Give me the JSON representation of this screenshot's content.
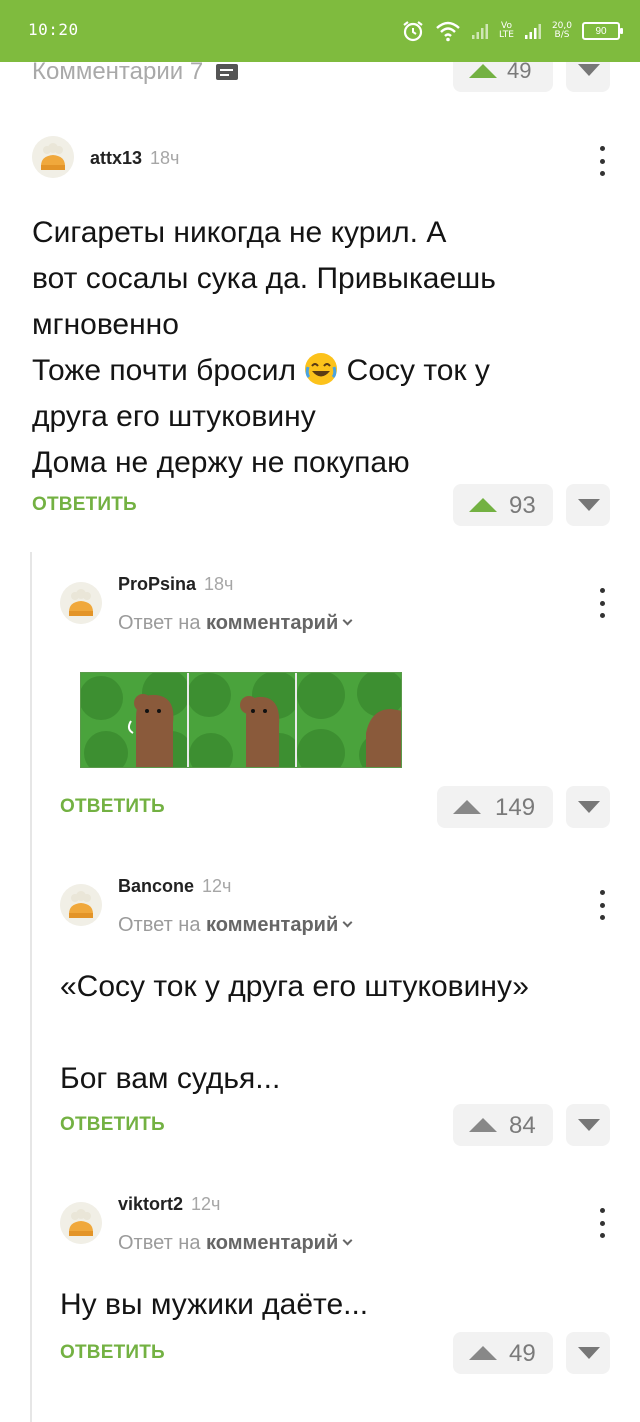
{
  "status_bar": {
    "time": "10:20",
    "volte": "Vo",
    "lte": "LTE",
    "net_speed_value": "20,0",
    "net_speed_unit": "B/S",
    "battery": "90"
  },
  "header": {
    "comments_label": "Комментарии 7",
    "rating": "49"
  },
  "comments": [
    {
      "author": "attx13",
      "time": "18ч",
      "lines": [
        "Сигареты никогда не курил. А",
        "вот сосалы сука да. Привыкаешь",
        "мгновенно"
      ],
      "line_emoji_before": "Тоже почти бросил",
      "line_emoji_after": "Сосу ток у",
      "lines2": [
        "друга его штуковину",
        "Дома не держу не покупаю"
      ],
      "reply_label": "Ответить",
      "rating": "93"
    },
    {
      "author": "ProPsina",
      "time": "18ч",
      "reply_prefix": "Ответ на",
      "reply_target": "комментарий",
      "reply_label": "Ответить",
      "rating": "149"
    },
    {
      "author": "Bancone",
      "time": "12ч",
      "reply_prefix": "Ответ на",
      "reply_target": "комментарий",
      "quote": "«Сосу ток у друга его штуковину»",
      "text": "Бог вам судья...",
      "reply_label": "Ответить",
      "rating": "84"
    },
    {
      "author": "viktort2",
      "time": "12ч",
      "reply_prefix": "Ответ на",
      "reply_target": "комментарий",
      "text": "Ну вы мужики даёте...",
      "reply_label": "Ответить",
      "rating": "49"
    }
  ],
  "colors": {
    "status_bar": "#7fbb3e",
    "accent_green": "#73b142",
    "vote_bg": "#f2f2f2"
  }
}
